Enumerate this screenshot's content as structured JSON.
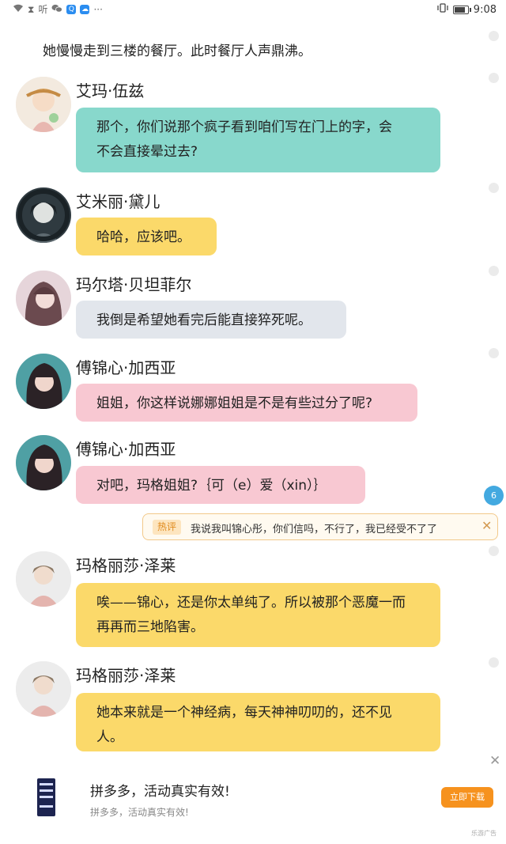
{
  "status_bar": {
    "time": "9:08",
    "ting": "听"
  },
  "narration": "她慢慢走到三楼的餐厅。此时餐厅人声鼎沸。",
  "messages": [
    {
      "speaker": "艾玛·伍兹",
      "lines": [
        "那个，你们说那个疯子看到咱们写在门上的字，会",
        "不会直接晕过去?"
      ],
      "color": "#88d8cc"
    },
    {
      "speaker": "艾米丽·黛儿",
      "lines": [
        "哈哈，应该吧。"
      ],
      "color": "#fbd96a"
    },
    {
      "speaker": "玛尔塔·贝坦菲尔",
      "lines": [
        "我倒是希望她看完后能直接猝死呢。"
      ],
      "color": "#e2e6ec"
    },
    {
      "speaker": "傅锦心·加西亚",
      "lines": [
        "姐姐，你这样说娜娜姐姐是不是有些过分了呢?"
      ],
      "color": "#f8c8d2"
    },
    {
      "speaker": "傅锦心·加西亚",
      "lines": [
        "对吧，玛格姐姐?｛可（e）爱（xin）｝"
      ],
      "color": "#f8c8d2"
    },
    {
      "speaker": "玛格丽莎·泽莱",
      "lines": [
        "唉——锦心，还是你太单纯了。所以被那个恶魔一而",
        "再再而三地陷害。"
      ],
      "color": "#fbd96a"
    },
    {
      "speaker": "玛格丽莎·泽莱",
      "lines": [
        "她本来就是一个神经病，每天神神叨叨的，还不见",
        "人。"
      ],
      "color": "#fbd96a"
    }
  ],
  "hot_comment": {
    "count": "6",
    "badge": "热评",
    "text": "我说我叫锦心彤，你们信吗，不行了，我已经受不了了"
  },
  "ad": {
    "title": "拼多多，活动真实有效!",
    "subtitle": "拼多多，活动真实有效!",
    "button": "立即下载",
    "tag": "乐游广告"
  }
}
